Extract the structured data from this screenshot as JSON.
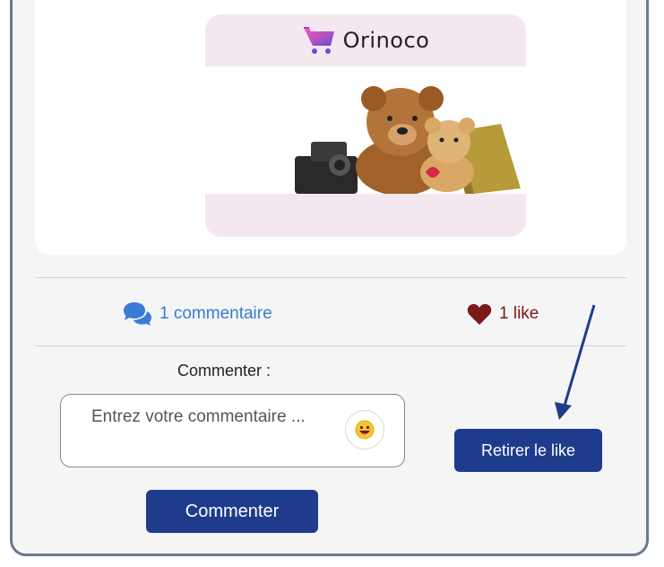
{
  "post": {
    "logo_text": "Orinoco"
  },
  "stats": {
    "comments_label": "1 commentaire",
    "likes_label": "1 like"
  },
  "comment_form": {
    "label": "Commenter :",
    "placeholder": "Entrez votre commentaire ...",
    "emoji_icon": "grinning-face-emoji",
    "submit_label": "Commenter"
  },
  "like_action": {
    "label": "Retirer le like"
  },
  "colors": {
    "primary_button": "#1f3b8c",
    "comments_link": "#3a7bd5",
    "likes_text": "#7a1a1a",
    "annotation_arrow": "#1f3b8c"
  }
}
